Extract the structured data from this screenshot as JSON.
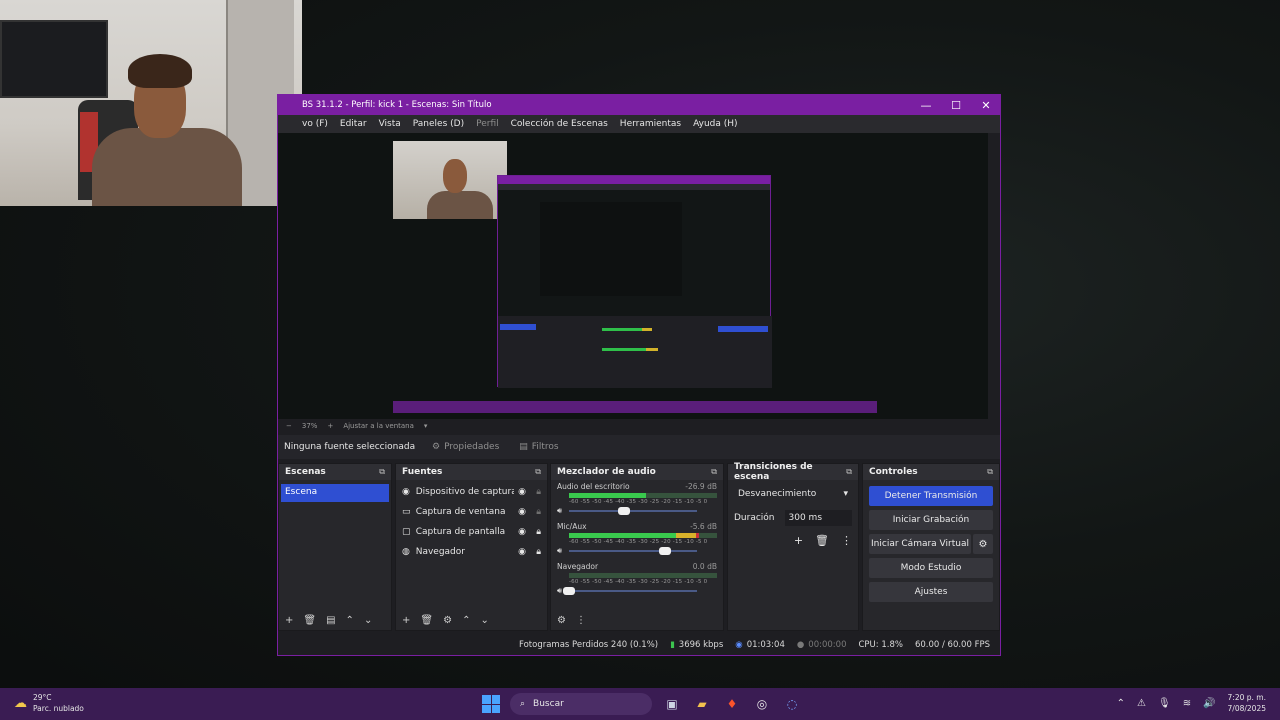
{
  "window": {
    "title": "BS 31.1.2 - Perfil: kick 1 - Escenas: Sin Título",
    "minimize": "—",
    "maximize": "☐",
    "close": "✕"
  },
  "menu": [
    "vo (F)",
    "Editar",
    "Vista",
    "Paneles (D)",
    "Perfil",
    "Colección de Escenas",
    "Herramientas",
    "Ayuda (H)"
  ],
  "zoom": {
    "minus": "−",
    "value": "37%",
    "plus": "+",
    "fit": "Ajustar a la ventana",
    "arrow": "▾"
  },
  "source_toolbar": {
    "no_selection": "Ninguna fuente seleccionada",
    "properties": "Propiedades",
    "filters": "Filtros"
  },
  "docks": {
    "scenes": {
      "title": "Escenas",
      "items": [
        "Escena"
      ]
    },
    "sources": {
      "title": "Fuentes",
      "items": [
        {
          "label": "Dispositivo de captura",
          "icon": "camera-icon",
          "glyph": "◉",
          "locked": false
        },
        {
          "label": "Captura de ventana",
          "icon": "window-icon",
          "glyph": "▭",
          "locked": false
        },
        {
          "label": "Captura de pantalla",
          "icon": "monitor-icon",
          "glyph": "▢",
          "locked": true
        },
        {
          "label": "Navegador",
          "icon": "globe-icon",
          "glyph": "◍",
          "locked": true
        }
      ]
    },
    "mixer": {
      "title": "Mezclador de audio",
      "scale": "-60 -55 -50 -45 -40 -35 -30 -25 -20 -15 -10 -5 0",
      "channels": [
        {
          "name": "Audio del escritorio",
          "db": "-26.9 dB",
          "level": 0.52,
          "volume": 0.43
        },
        {
          "name": "Mic/Aux",
          "db": "-5.6 dB",
          "level": 0.88,
          "volume": 0.75
        },
        {
          "name": "Navegador",
          "db": "0.0 dB",
          "level": 0.0,
          "volume": 0.0
        }
      ]
    },
    "transitions": {
      "title": "Transiciones de escena",
      "selected": "Desvanecimiento",
      "duration_label": "Duración",
      "duration_value": "300 ms"
    },
    "controls": {
      "title": "Controles",
      "stop_stream": "Detener Transmisión",
      "start_recording": "Iniciar Grabación",
      "start_virtual_cam": "Iniciar Cámara Virtual",
      "studio_mode": "Modo Estudio",
      "settings": "Ajustes"
    }
  },
  "statusbar": {
    "dropped_frames": "Fotogramas Perdidos 240 (0.1%)",
    "bitrate": "3696 kbps",
    "stream_time": "01:03:04",
    "record_time": "00:00:00",
    "cpu": "CPU: 1.8%",
    "fps": "60.00 / 60.00 FPS"
  },
  "taskbar": {
    "weather_temp": "29°C",
    "weather_desc": "Parc. nublado",
    "search_placeholder": "Buscar",
    "time": "7:20 p. m.",
    "date": "7/08/2025"
  },
  "colors": {
    "accent": "#2f4fd2",
    "titlebar": "#7a1fa2",
    "taskbar": "#3a1c53"
  }
}
